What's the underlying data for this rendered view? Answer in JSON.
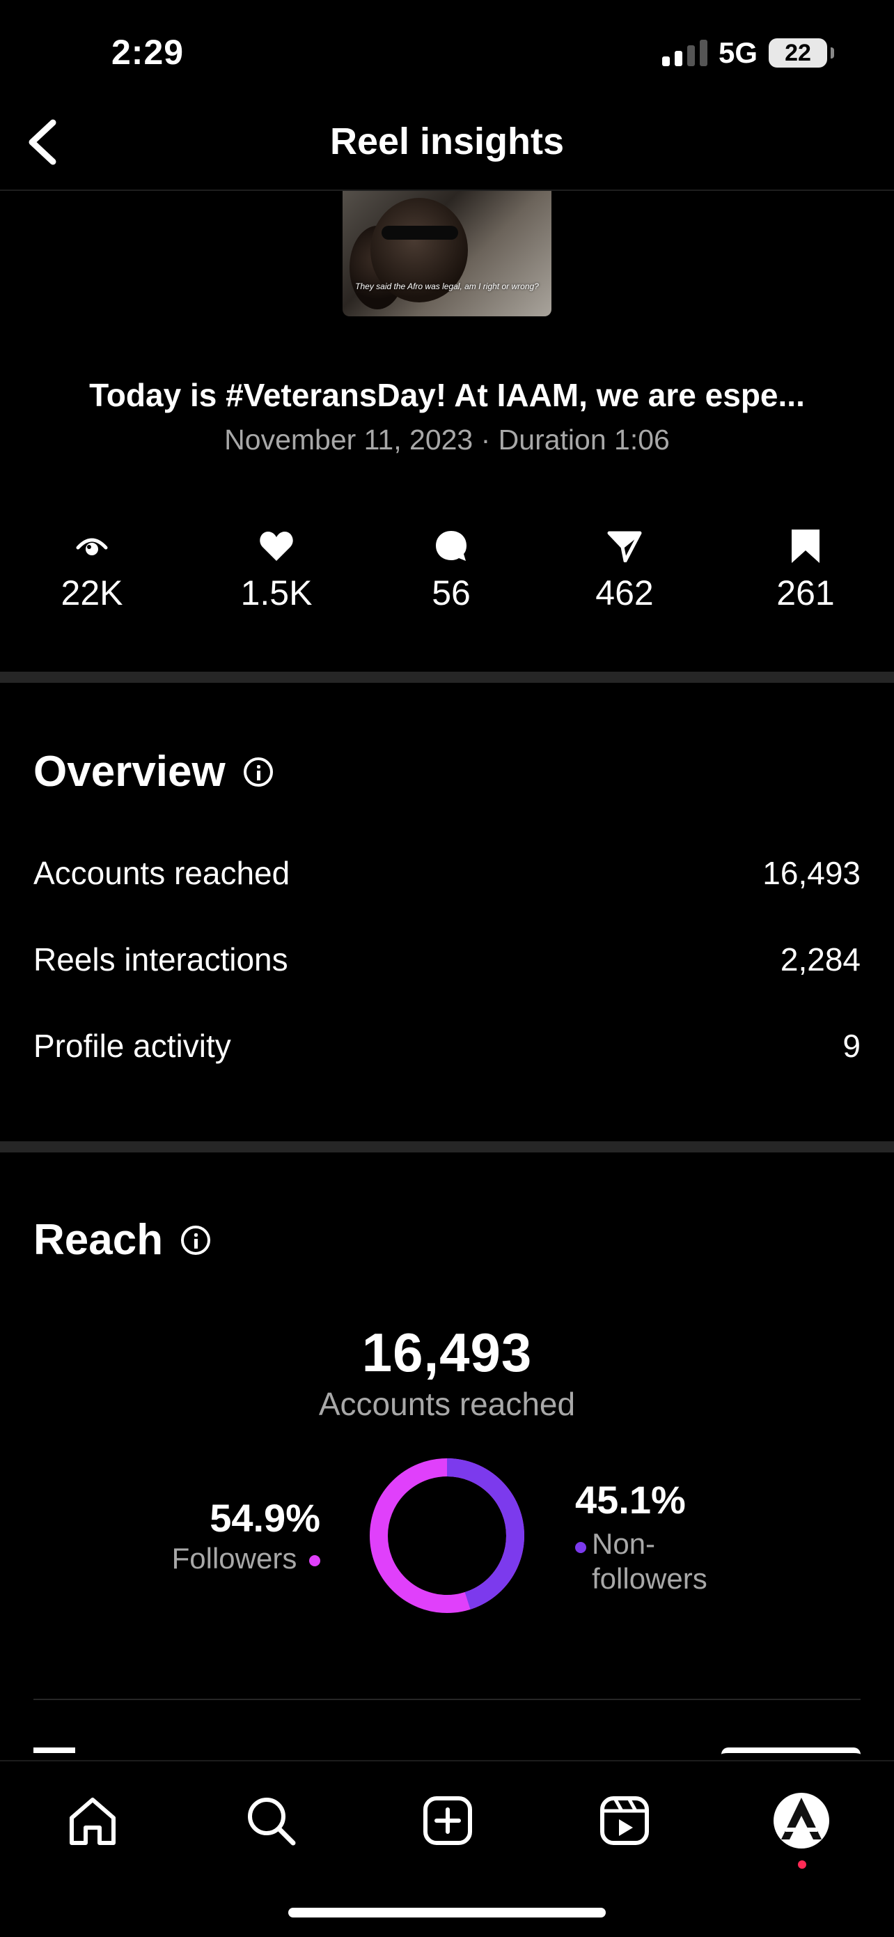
{
  "status_bar": {
    "time": "2:29",
    "network": "5G",
    "battery": "22"
  },
  "header": {
    "title": "Reel insights"
  },
  "post": {
    "thumbnail_caption": "They said the Afro was legal, am I right or wrong?",
    "title": "Today is #VeteransDay! At IAAM, we are espe...",
    "meta": "November 11, 2023 · Duration 1:06"
  },
  "metrics": [
    {
      "icon": "eye-icon",
      "value": "22K"
    },
    {
      "icon": "heart-icon",
      "value": "1.5K"
    },
    {
      "icon": "comment-icon",
      "value": "56"
    },
    {
      "icon": "share-icon",
      "value": "462"
    },
    {
      "icon": "bookmark-icon",
      "value": "261"
    }
  ],
  "overview": {
    "heading": "Overview",
    "rows": [
      {
        "label": "Accounts reached",
        "value": "16,493"
      },
      {
        "label": "Reels interactions",
        "value": "2,284"
      },
      {
        "label": "Profile activity",
        "value": "9"
      }
    ]
  },
  "reach": {
    "heading": "Reach",
    "total": "16,493",
    "total_label": "Accounts reached",
    "followers_pct": "54.9%",
    "followers_label": "Followers",
    "followers_fraction": 0.549,
    "nonfollowers_pct": "45.1%",
    "nonfollowers_label_1": "Non-",
    "nonfollowers_label_2": "followers",
    "followers_color": "#e040fb",
    "nonfollowers_color": "#7c3aed"
  },
  "tabs": [
    "home-icon",
    "search-icon",
    "create-icon",
    "reels-icon",
    "profile-avatar"
  ]
}
